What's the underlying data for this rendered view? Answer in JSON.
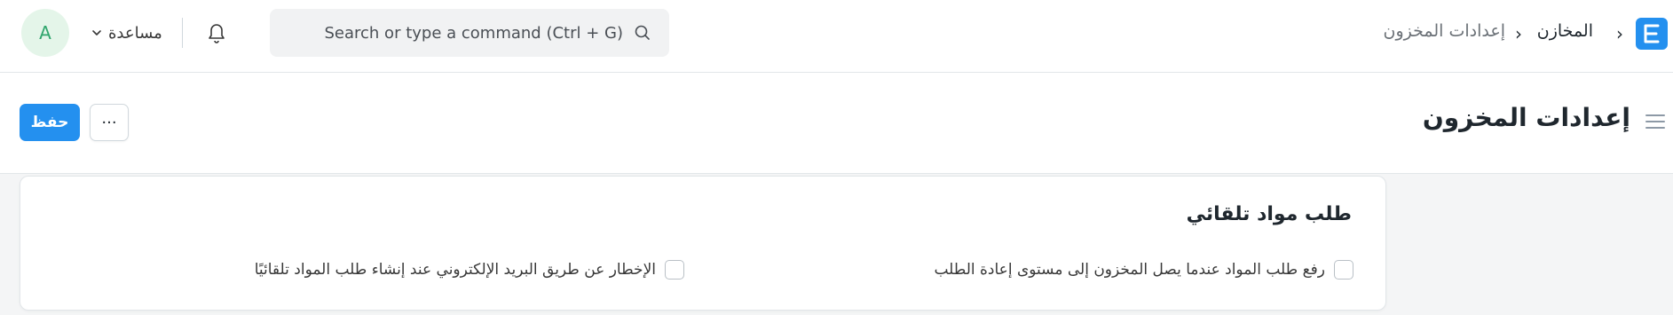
{
  "navbar": {
    "avatar_initial": "A",
    "help_label": "مساعدة",
    "search_placeholder": "Search or type a command (Ctrl + G)",
    "breadcrumbs": [
      "المخازن",
      "إعدادات المخزون"
    ],
    "logo_letter": "E"
  },
  "page": {
    "title": "إعدادات المخزون",
    "save_label": "حفظ",
    "more_label": "···"
  },
  "section": {
    "title": "طلب مواد تلقائي",
    "checkboxes": [
      {
        "label": "رفع طلب المواد عندما يصل المخزون إلى مستوى إعادة الطلب",
        "checked": false
      },
      {
        "label": "الإخطار عن طريق البريد الإلكتروني عند إنشاء طلب المواد تلقائيًا",
        "checked": false
      }
    ]
  },
  "colors": {
    "primary": "#2490ef",
    "avatar_bg": "#e4f5e9",
    "avatar_fg": "#30a66d"
  }
}
